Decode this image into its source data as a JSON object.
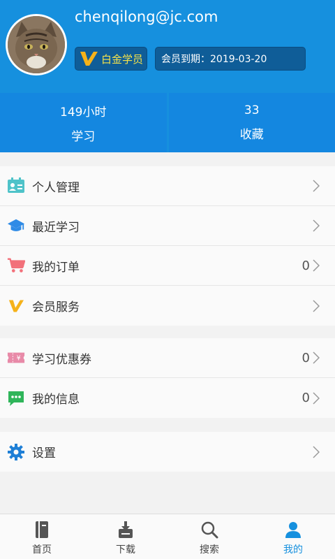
{
  "profile": {
    "email": "chenqilong@jc.com",
    "member_level": "白金学员",
    "expire_label": "会员到期：2019-03-20"
  },
  "stats": [
    {
      "value": "149小时",
      "label": "学习"
    },
    {
      "value": "33",
      "label": "收藏"
    }
  ],
  "menu_group_1": [
    {
      "label": "个人管理",
      "icon": "contact-card-icon"
    },
    {
      "label": "最近学习",
      "icon": "graduation-cap-icon"
    },
    {
      "label": "我的订单",
      "icon": "shopping-cart-icon",
      "count": "0"
    },
    {
      "label": "会员服务",
      "icon": "vip-v-icon"
    }
  ],
  "menu_group_2": [
    {
      "label": "学习优惠券",
      "icon": "coupon-icon",
      "count": "0"
    },
    {
      "label": "我的信息",
      "icon": "message-icon",
      "count": "0"
    }
  ],
  "menu_group_3": [
    {
      "label": "设置",
      "icon": "gear-icon"
    }
  ],
  "tabs": [
    {
      "label": "首页",
      "icon": "book-icon"
    },
    {
      "label": "下载",
      "icon": "download-tray-icon"
    },
    {
      "label": "搜索",
      "icon": "search-icon"
    },
    {
      "label": "我的",
      "icon": "user-icon",
      "active": true
    }
  ],
  "colors": {
    "primary": "#1690de",
    "vip_gold": "#f5b21a",
    "badge_text": "#f5e24a"
  }
}
